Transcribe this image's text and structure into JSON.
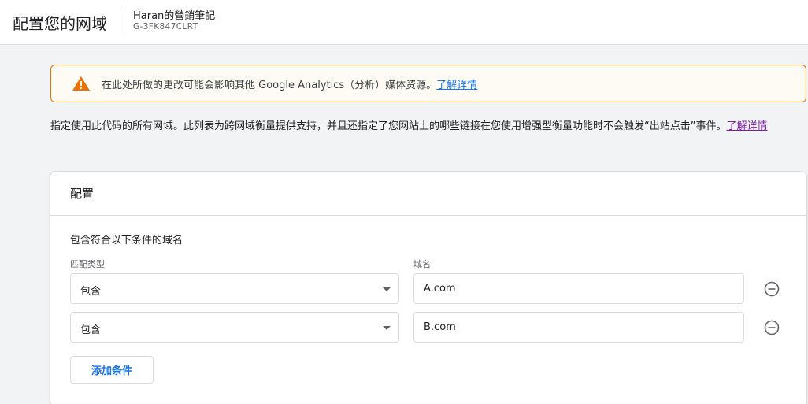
{
  "header": {
    "page_title": "配置您的网域",
    "account_name": "Haran的營銷筆記",
    "account_id": "G-3FK847CLRT"
  },
  "warning": {
    "icon": "warning-icon",
    "color": "#e37400",
    "text": "在此处所做的更改可能会影响其他 Google Analytics（分析）媒体资源。",
    "link": "了解详情"
  },
  "description": {
    "text": "指定使用此代码的所有网域。此列表为跨网域衡量提供支持，并且还指定了您网站上的哪些链接在您使用增强型衡量功能时不会触发“出站点击”事件。",
    "link": "了解详情"
  },
  "card": {
    "title": "配置",
    "condition_title": "包含符合以下条件的域名",
    "match_type_label": "匹配类型",
    "domain_label": "域名",
    "rows": [
      {
        "match_type": "包含",
        "domain": "A.com",
        "remove_icon": "remove-circle-icon"
      },
      {
        "match_type": "包含",
        "domain": "B.com",
        "remove_icon": "remove-circle-icon"
      }
    ],
    "add_button": "添加条件"
  },
  "colors": {
    "link": "#1a73e8",
    "visited_link": "#7b1fa2",
    "warning_border": "#e37400",
    "background": "#f1f3f4"
  }
}
